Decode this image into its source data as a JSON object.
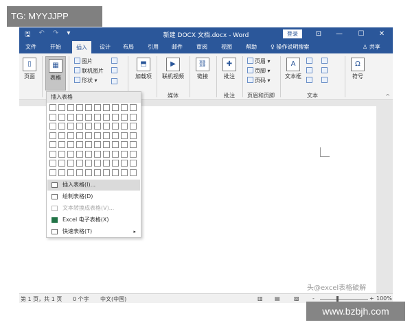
{
  "overlay": {
    "tg_label": "TG: MYYJJPP",
    "watermark": "头@excel表格破解",
    "site_url": "www.bzbjh.com"
  },
  "titlebar": {
    "qat": {
      "save": "🖫",
      "undo": "↶",
      "redo": "↷",
      "customize": "▾"
    },
    "title": "新建 DOCX 文档.docx - Word",
    "login": "登录",
    "restore_icon": "⊡",
    "minimize": "—",
    "maximize": "☐",
    "close": "✕"
  },
  "tabs": [
    "文件",
    "开始",
    "插入",
    "设计",
    "布局",
    "引用",
    "邮件",
    "审阅",
    "视图",
    "帮助"
  ],
  "active_tab": "插入",
  "tell_me": "♀ 操作说明搜索",
  "share": "♙ 共享",
  "ribbon": {
    "pages": "页面",
    "table": "表格",
    "pictures": "图片",
    "online_pictures": "联机图片",
    "shapes": "形状 ▾",
    "addins": "加载项",
    "online_video": "联机视频",
    "media_group": "媒体",
    "link": "链接",
    "comment": "批注",
    "comment_group": "批注",
    "header": "页眉 ▾",
    "footer": "页脚 ▾",
    "page_number": "页码 ▾",
    "header_footer_group": "页眉和页脚",
    "textbox": "文本框",
    "text_group": "文本",
    "symbol": "符号",
    "symbol_glyph": "Ω",
    "collapse": "^"
  },
  "dropdown": {
    "header": "插入表格",
    "grid_cols": 10,
    "grid_rows": 8,
    "items": [
      {
        "label": "插入表格(I)...",
        "state": "highlighted"
      },
      {
        "label": "绘制表格(D)",
        "state": "normal"
      },
      {
        "label": "文本转换成表格(V)...",
        "state": "disabled"
      },
      {
        "label": "Excel 电子表格(X)",
        "state": "normal"
      },
      {
        "label": "快速表格(T)",
        "state": "normal",
        "submenu": "▸"
      }
    ]
  },
  "status": {
    "page": "第 1 页，共 1 页",
    "words": "0 个字",
    "language": "中文(中国)",
    "zoom_minus": "-",
    "zoom_plus": "+",
    "zoom": "100%"
  }
}
